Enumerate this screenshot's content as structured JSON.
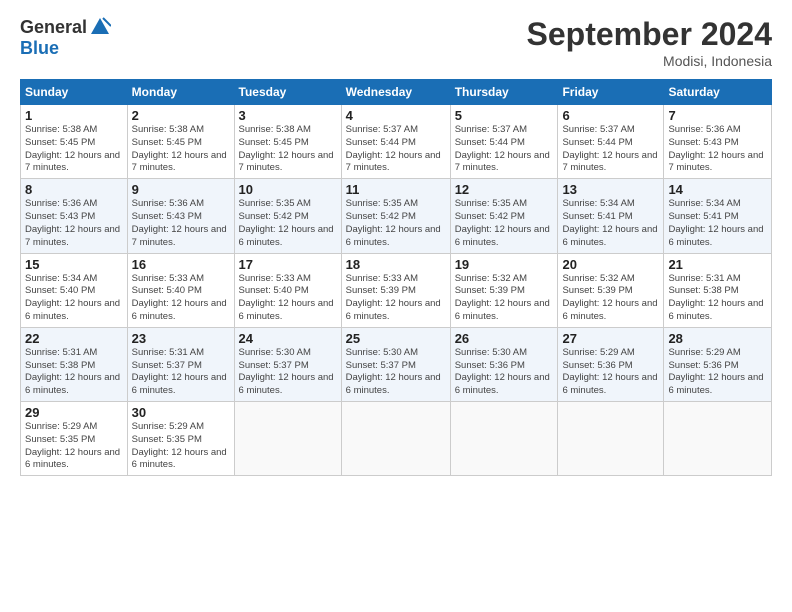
{
  "logo": {
    "general": "General",
    "blue": "Blue"
  },
  "title": "September 2024",
  "location": "Modisi, Indonesia",
  "weekdays": [
    "Sunday",
    "Monday",
    "Tuesday",
    "Wednesday",
    "Thursday",
    "Friday",
    "Saturday"
  ],
  "weeks": [
    [
      {
        "day": "1",
        "sunrise": "5:38 AM",
        "sunset": "5:45 PM",
        "daylight": "12 hours and 7 minutes."
      },
      {
        "day": "2",
        "sunrise": "5:38 AM",
        "sunset": "5:45 PM",
        "daylight": "12 hours and 7 minutes."
      },
      {
        "day": "3",
        "sunrise": "5:38 AM",
        "sunset": "5:45 PM",
        "daylight": "12 hours and 7 minutes."
      },
      {
        "day": "4",
        "sunrise": "5:37 AM",
        "sunset": "5:44 PM",
        "daylight": "12 hours and 7 minutes."
      },
      {
        "day": "5",
        "sunrise": "5:37 AM",
        "sunset": "5:44 PM",
        "daylight": "12 hours and 7 minutes."
      },
      {
        "day": "6",
        "sunrise": "5:37 AM",
        "sunset": "5:44 PM",
        "daylight": "12 hours and 7 minutes."
      },
      {
        "day": "7",
        "sunrise": "5:36 AM",
        "sunset": "5:43 PM",
        "daylight": "12 hours and 7 minutes."
      }
    ],
    [
      {
        "day": "8",
        "sunrise": "5:36 AM",
        "sunset": "5:43 PM",
        "daylight": "12 hours and 7 minutes."
      },
      {
        "day": "9",
        "sunrise": "5:36 AM",
        "sunset": "5:43 PM",
        "daylight": "12 hours and 7 minutes."
      },
      {
        "day": "10",
        "sunrise": "5:35 AM",
        "sunset": "5:42 PM",
        "daylight": "12 hours and 6 minutes."
      },
      {
        "day": "11",
        "sunrise": "5:35 AM",
        "sunset": "5:42 PM",
        "daylight": "12 hours and 6 minutes."
      },
      {
        "day": "12",
        "sunrise": "5:35 AM",
        "sunset": "5:42 PM",
        "daylight": "12 hours and 6 minutes."
      },
      {
        "day": "13",
        "sunrise": "5:34 AM",
        "sunset": "5:41 PM",
        "daylight": "12 hours and 6 minutes."
      },
      {
        "day": "14",
        "sunrise": "5:34 AM",
        "sunset": "5:41 PM",
        "daylight": "12 hours and 6 minutes."
      }
    ],
    [
      {
        "day": "15",
        "sunrise": "5:34 AM",
        "sunset": "5:40 PM",
        "daylight": "12 hours and 6 minutes."
      },
      {
        "day": "16",
        "sunrise": "5:33 AM",
        "sunset": "5:40 PM",
        "daylight": "12 hours and 6 minutes."
      },
      {
        "day": "17",
        "sunrise": "5:33 AM",
        "sunset": "5:40 PM",
        "daylight": "12 hours and 6 minutes."
      },
      {
        "day": "18",
        "sunrise": "5:33 AM",
        "sunset": "5:39 PM",
        "daylight": "12 hours and 6 minutes."
      },
      {
        "day": "19",
        "sunrise": "5:32 AM",
        "sunset": "5:39 PM",
        "daylight": "12 hours and 6 minutes."
      },
      {
        "day": "20",
        "sunrise": "5:32 AM",
        "sunset": "5:39 PM",
        "daylight": "12 hours and 6 minutes."
      },
      {
        "day": "21",
        "sunrise": "5:31 AM",
        "sunset": "5:38 PM",
        "daylight": "12 hours and 6 minutes."
      }
    ],
    [
      {
        "day": "22",
        "sunrise": "5:31 AM",
        "sunset": "5:38 PM",
        "daylight": "12 hours and 6 minutes."
      },
      {
        "day": "23",
        "sunrise": "5:31 AM",
        "sunset": "5:37 PM",
        "daylight": "12 hours and 6 minutes."
      },
      {
        "day": "24",
        "sunrise": "5:30 AM",
        "sunset": "5:37 PM",
        "daylight": "12 hours and 6 minutes."
      },
      {
        "day": "25",
        "sunrise": "5:30 AM",
        "sunset": "5:37 PM",
        "daylight": "12 hours and 6 minutes."
      },
      {
        "day": "26",
        "sunrise": "5:30 AM",
        "sunset": "5:36 PM",
        "daylight": "12 hours and 6 minutes."
      },
      {
        "day": "27",
        "sunrise": "5:29 AM",
        "sunset": "5:36 PM",
        "daylight": "12 hours and 6 minutes."
      },
      {
        "day": "28",
        "sunrise": "5:29 AM",
        "sunset": "5:36 PM",
        "daylight": "12 hours and 6 minutes."
      }
    ],
    [
      {
        "day": "29",
        "sunrise": "5:29 AM",
        "sunset": "5:35 PM",
        "daylight": "12 hours and 6 minutes."
      },
      {
        "day": "30",
        "sunrise": "5:29 AM",
        "sunset": "5:35 PM",
        "daylight": "12 hours and 6 minutes."
      },
      null,
      null,
      null,
      null,
      null
    ]
  ]
}
